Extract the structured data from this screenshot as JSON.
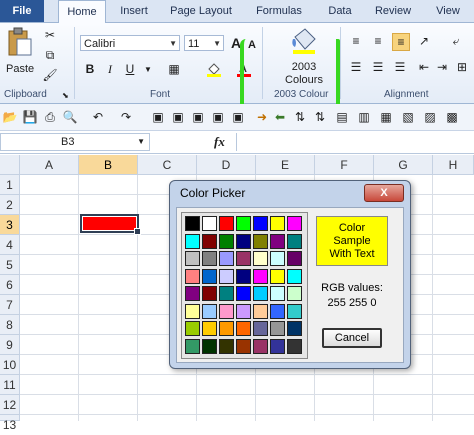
{
  "ribbon": {
    "tabs": [
      "File",
      "Home",
      "Insert",
      "Page Layout",
      "Formulas",
      "Data",
      "Review",
      "View"
    ],
    "font_name": "Calibri",
    "font_size": "11",
    "groups": {
      "clipboard": "Clipboard",
      "font": "Font",
      "colours": "2003 Colour",
      "alignment": "Alignment"
    },
    "paste_label": "Paste",
    "colour_button": {
      "line1": "2003",
      "line2": "Colours"
    },
    "bold": "B",
    "italic": "I",
    "underline": "U",
    "grow_font": "A",
    "shrink_font": "A"
  },
  "formula_bar": {
    "name_box": "B3",
    "fx": "fx"
  },
  "sheet": {
    "columns": [
      "A",
      "B",
      "C",
      "D",
      "E",
      "F",
      "G",
      "H"
    ],
    "rows": [
      "1",
      "2",
      "3",
      "4",
      "5",
      "6",
      "7",
      "8",
      "9",
      "10",
      "11",
      "12",
      "13"
    ],
    "selected_column": "B",
    "selected_row": "3",
    "selected_cell_fill": "#ff0000"
  },
  "dialog": {
    "title": "Color Picker",
    "close_label": "X",
    "sample_text": [
      "Color",
      "Sample",
      "With Text"
    ],
    "sample_color": "#ffff00",
    "rgb_label": "RGB values:",
    "rgb_value": "255 255 0",
    "cancel_label": "Cancel",
    "palette": [
      [
        "#000000",
        "#ffffff",
        "#ff0000",
        "#00ff00",
        "#0000ff",
        "#ffff00",
        "#ff00ff"
      ],
      [
        "#00ffff",
        "#800000",
        "#008000",
        "#000080",
        "#808000",
        "#800080",
        "#008080"
      ],
      [
        "#c0c0c0",
        "#808080",
        "#9999ff",
        "#993366",
        "#ffffcc",
        "#ccffff",
        "#660066"
      ],
      [
        "#ff8080",
        "#0066cc",
        "#ccccff",
        "#000080",
        "#ff00ff",
        "#ffff00",
        "#00ffff"
      ],
      [
        "#800080",
        "#800000",
        "#008080",
        "#0000ff",
        "#00ccff",
        "#ccffff",
        "#ccffcc"
      ],
      [
        "#ffff99",
        "#99ccff",
        "#ff99cc",
        "#cc99ff",
        "#ffcc99",
        "#3366ff",
        "#33cccc"
      ],
      [
        "#99cc00",
        "#ffcc00",
        "#ff9900",
        "#ff6600",
        "#666699",
        "#969696",
        "#003366"
      ],
      [
        "#339966",
        "#003300",
        "#333300",
        "#993300",
        "#993366",
        "#333399",
        "#333333"
      ]
    ]
  }
}
